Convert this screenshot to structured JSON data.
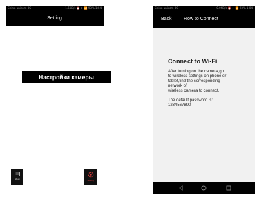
{
  "left_screen": {
    "status": {
      "carrier": "China unicom 3G",
      "info": "1.6KB/s ⏰ ✈ 📶 93% 1:04"
    },
    "title": "Setting",
    "banner": "Настройки камеры",
    "buttons": {
      "album": "album",
      "setting": "Setting"
    }
  },
  "right_screen": {
    "status": {
      "carrier": "China unicom 3G",
      "info": "0.0KB/s ⏰ ✈ 📶 93% 1:04"
    },
    "header": {
      "back": "Back",
      "title": "How to Connect"
    },
    "heading": "Connect to Wi-Fi",
    "body": [
      "After turning on the camera,go",
      "to wireless settings on phone or",
      "tablet,find the corresponding",
      "network of",
      "wireless camera to connect."
    ],
    "password": [
      "The default password is:",
      "1234567890"
    ]
  },
  "colors": {
    "bar": "#000000",
    "accent_red": "#d23a3a",
    "content_bg": "#f1f1f1"
  }
}
